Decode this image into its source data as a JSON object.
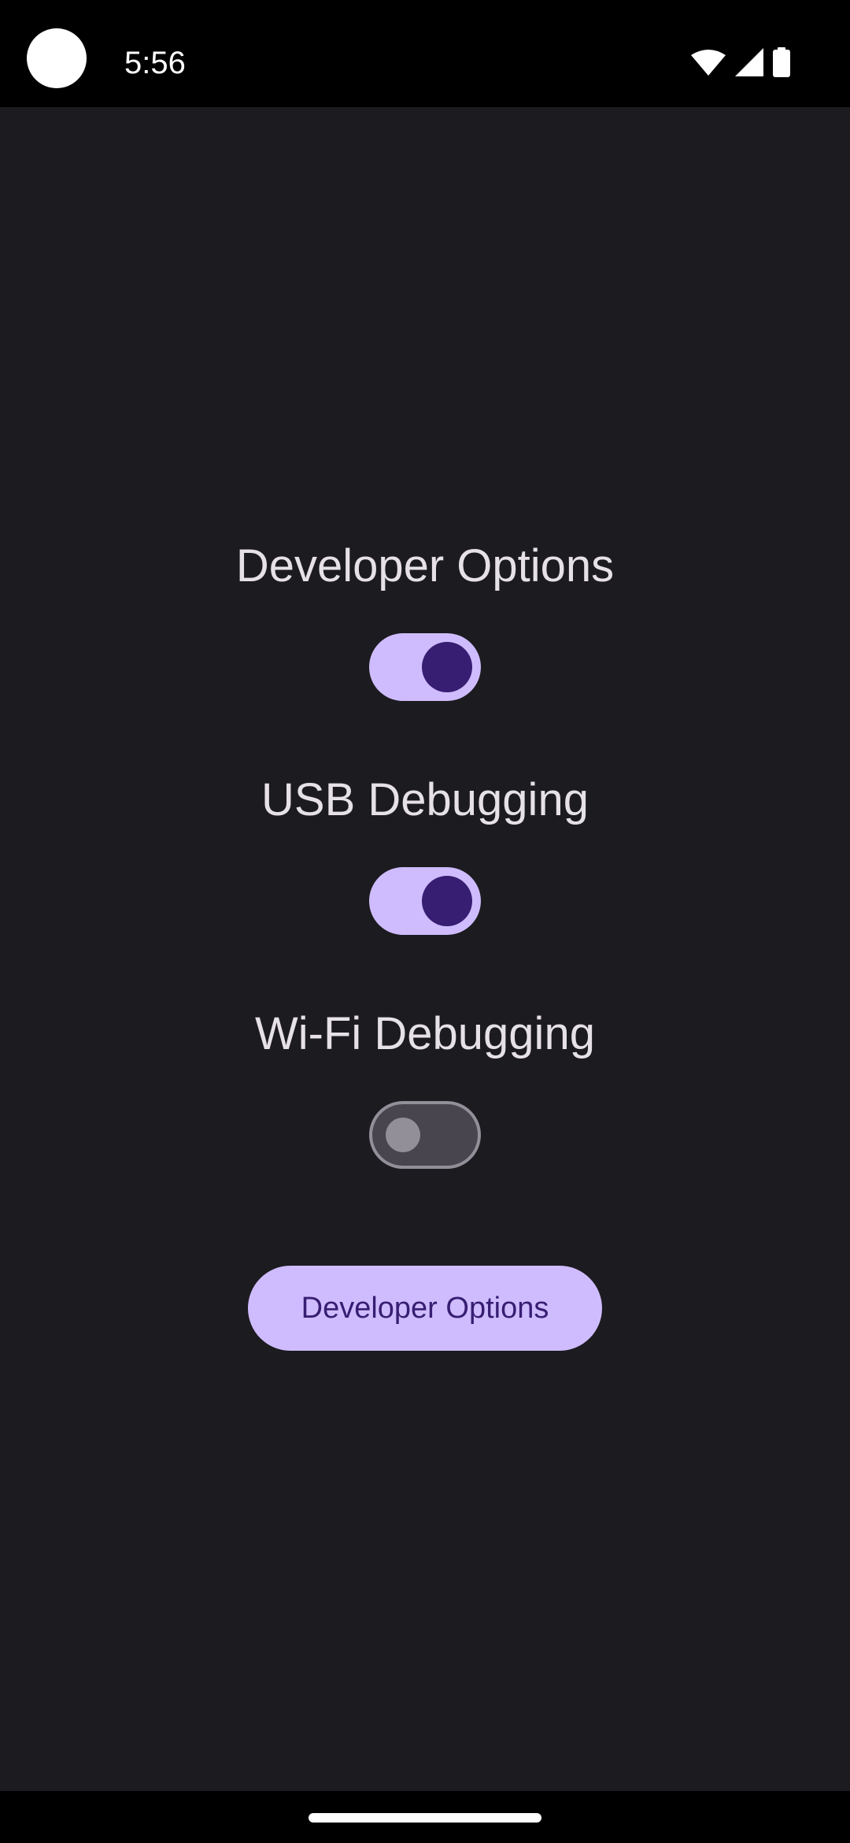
{
  "status_bar": {
    "time": "5:56",
    "icons": [
      "wifi-icon",
      "cellular-signal-icon",
      "battery-icon"
    ]
  },
  "settings": {
    "developer_options": {
      "label": "Developer Options",
      "enabled": true
    },
    "usb_debugging": {
      "label": "USB Debugging",
      "enabled": true
    },
    "wifi_debugging": {
      "label": "Wi-Fi Debugging",
      "enabled": false
    }
  },
  "button": {
    "label": "Developer Options"
  },
  "colors": {
    "background": "#1c1b20",
    "accent": "#cfbcff",
    "accent_dark": "#381e72",
    "text": "#e6e1e6",
    "switch_off_track": "#49454f",
    "switch_off_outline": "#938f99"
  }
}
